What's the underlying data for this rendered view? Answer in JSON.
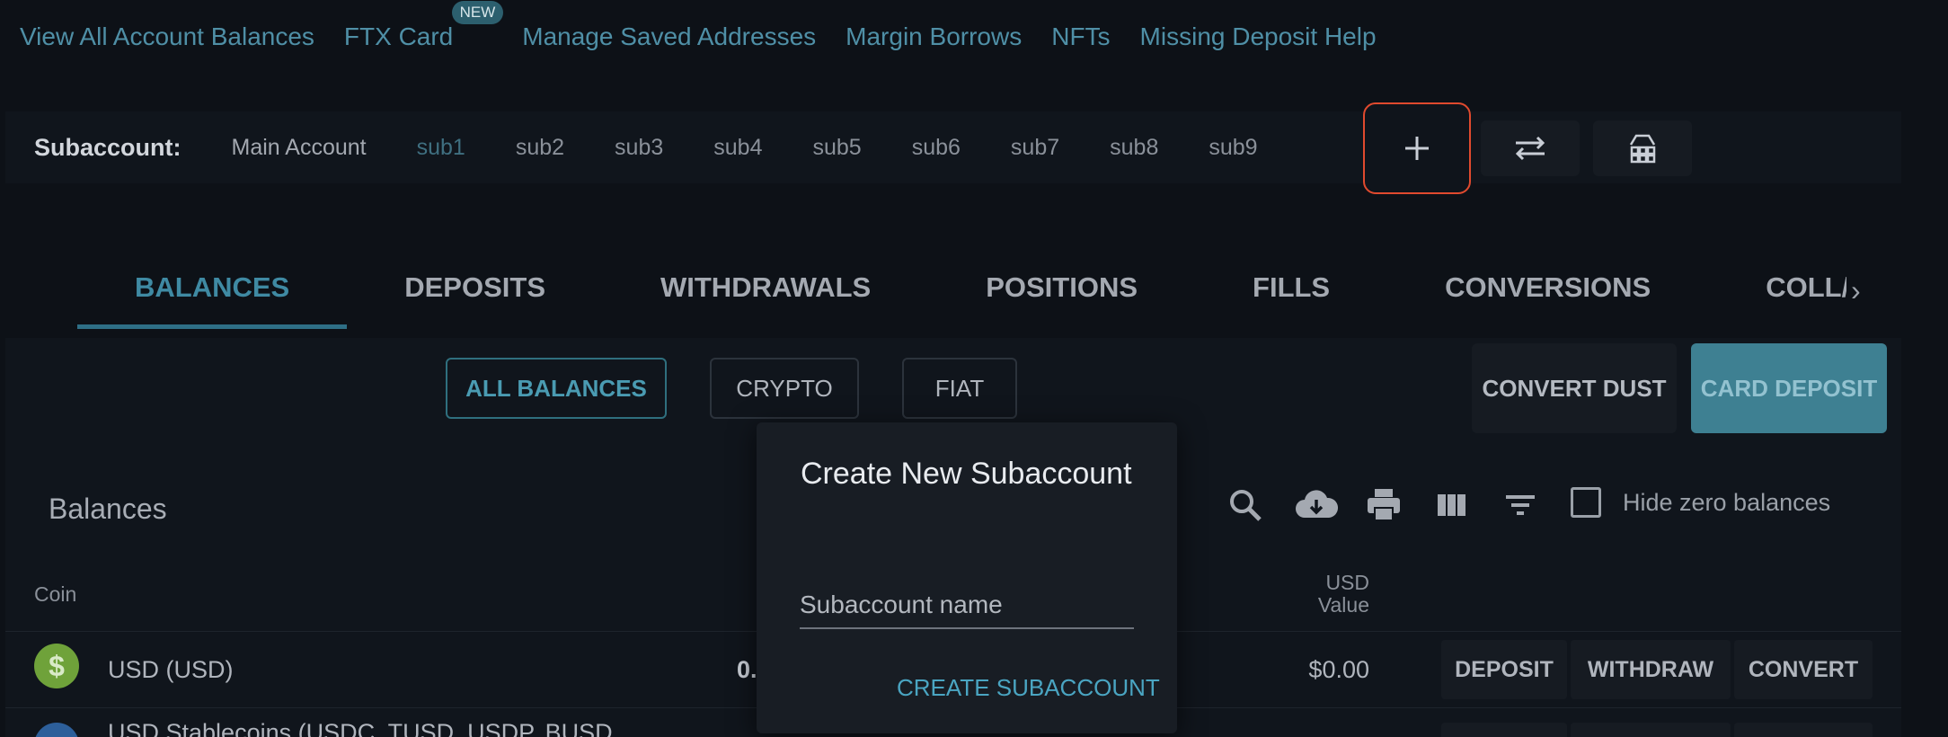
{
  "top_links": [
    {
      "label": "View All Account Balances"
    },
    {
      "label": "FTX Card",
      "badge": "NEW"
    },
    {
      "label": "Manage Saved Addresses"
    },
    {
      "label": "Margin Borrows"
    },
    {
      "label": "NFTs"
    },
    {
      "label": "Missing Deposit Help"
    }
  ],
  "subaccount": {
    "label": "Subaccount:",
    "items": [
      "Main Account",
      "sub1",
      "sub2",
      "sub3",
      "sub4",
      "sub5",
      "sub6",
      "sub7",
      "sub8",
      "sub9"
    ],
    "active": "sub1",
    "buttons": {
      "add_icon": "plus-icon",
      "transfer_icon": "swap-arrows-icon",
      "settings_icon": "piggy-bank-icon"
    }
  },
  "tabs": [
    "BALANCES",
    "DEPOSITS",
    "WITHDRAWALS",
    "POSITIONS",
    "FILLS",
    "CONVERSIONS",
    "COLL/"
  ],
  "filters": {
    "all": "ALL BALANCES",
    "crypto": "CRYPTO",
    "fiat": "FIAT"
  },
  "actions": {
    "convert_dust": "CONVERT DUST",
    "card_deposit": "CARD DEPOSIT"
  },
  "balances": {
    "title": "Balances",
    "hide_zero_label": "Hide zero balances",
    "columns": {
      "coin": "Coin",
      "usd_value_line1": "USD",
      "usd_value_line2": "Value"
    },
    "rows": [
      {
        "icon": "$",
        "name": "USD (USD)",
        "amount": "0.",
        "usd_value": "$0.00",
        "buttons": [
          "DEPOSIT",
          "WITHDRAW",
          "CONVERT"
        ]
      },
      {
        "name": "USD Stablecoins (USDC, TUSD, USDP, BUSD"
      }
    ]
  },
  "modal": {
    "title": "Create New Subaccount",
    "input_placeholder": "Subaccount name",
    "create_label": "CREATE SUBACCOUNT"
  },
  "colors": {
    "accent": "#3f8aa3",
    "highlight": "#e04a2e",
    "card_deposit": "#3e8092"
  }
}
